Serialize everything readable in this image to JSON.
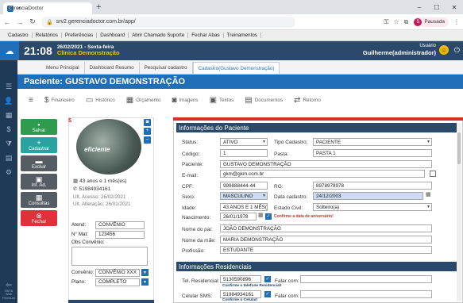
{
  "browser": {
    "tab_title": "GerenciaDoctor",
    "url": "srv2.gerenciadoctor.com.br/app/",
    "profile_initial": "S",
    "profile_status": "Pausada"
  },
  "app_menu": [
    "Cadastro",
    "Relatórios",
    "Preferências",
    "Dashboard",
    "Abrir Chamado Suporte",
    "Fechar Abas",
    "Treinamentos"
  ],
  "header": {
    "time": "21:08",
    "date": "26/02/2021 - Sexta-feira",
    "clinic": "Clínica Demonstração",
    "user_label": "Usuário",
    "user_name": "Guilherme(administrador)"
  },
  "sidebar": {
    "footer_line1": "25/76",
    "footer_line2": "Web",
    "footer_line3": "Premium"
  },
  "page_tabs": [
    "Menu Principal",
    "Dashboard Resumo",
    "Pesquisar cadastro",
    "Cadastro(Gustavo Demonstração)"
  ],
  "page_title": "Paciente: GUSTAVO DEMONSTRAÇÃO",
  "toolbar": [
    "Financeiro",
    "Histórico",
    "Orçamento",
    "Imagens",
    "Textos",
    "Documentos",
    "Retorno"
  ],
  "actions": {
    "save": "Salvar",
    "new": "Cadastrar",
    "delete": "Excluir",
    "info": "Inf. Ad.",
    "consults": "Consultas",
    "close": "Fechar"
  },
  "photo_watermark": "eficiente",
  "patient_card": {
    "age": "43 anos e 1 mês(es)",
    "phone": "51984934161",
    "last_access": "Ult. Acesso: 26/02/2021",
    "last_change": "Ult. Alteração: 26/01/2021",
    "attendant_label": "Atend:",
    "attendant_value": "CONVÊNIO",
    "number_label": "N° Mat:",
    "number_value": "123456",
    "obs_label": "Obs Convênio:",
    "insurance_label": "Convênio:",
    "insurance_value": "CONVÊNIO XXX",
    "plan_label": "Plano:",
    "plan_value": "COMPLETO"
  },
  "section_patient": "Informações do Paciente",
  "section_residential": "Informações Residenciais",
  "form": {
    "status_label": "Status:",
    "status_value": "ATIVO",
    "type_label": "Tipo Cadastro:",
    "type_value": "PACIENTE",
    "code_label": "Código:",
    "code_value": "1",
    "folder_label": "Pasta:",
    "folder_value": "PASTA 1",
    "patient_label": "Paciente:",
    "patient_value": "GUSTAVO DEMONSTRAÇÃO",
    "email_label": "E-mail:",
    "email_value": "gkm@gkm.com.br",
    "cpf_label": "CPF:",
    "cpf_value": "999888444-44",
    "rg_label": "RG:",
    "rg_value": "8978978978",
    "sex_label": "Sexo:",
    "sex_value": "MASCULINO",
    "regdate_label": "Data cadastro:",
    "regdate_value": "24/12/2003",
    "age_label": "Idade:",
    "age_value": "43 ANOS E 1 MÊS(ES)",
    "civil_label": "Estado Civil:",
    "civil_value": "Solteiro(a)",
    "birth_label": "Nascimento:",
    "birth_value": "26/01/1978",
    "birth_warning": "Confirme a data de aniversário!",
    "father_label": "Nome do pai:",
    "father_value": "JOÃO DEMONSTRAÇÃO",
    "mother_label": "Nome da mãe:",
    "mother_value": "MARIA DEMONSTRAÇÃO",
    "job_label": "Profissão:",
    "job_value": "ESTUDANTE",
    "tel_label": "Tel. Residencial:",
    "tel_value": "5130590896",
    "tel_note": "Confirme o telefone Residencial!",
    "talk_label": "Falar com:",
    "cell_label": "Celular SMS:",
    "cell_value": "51984934161",
    "cell_note": "Confirme o Celular!",
    "talk2_label": "Falar com:"
  }
}
